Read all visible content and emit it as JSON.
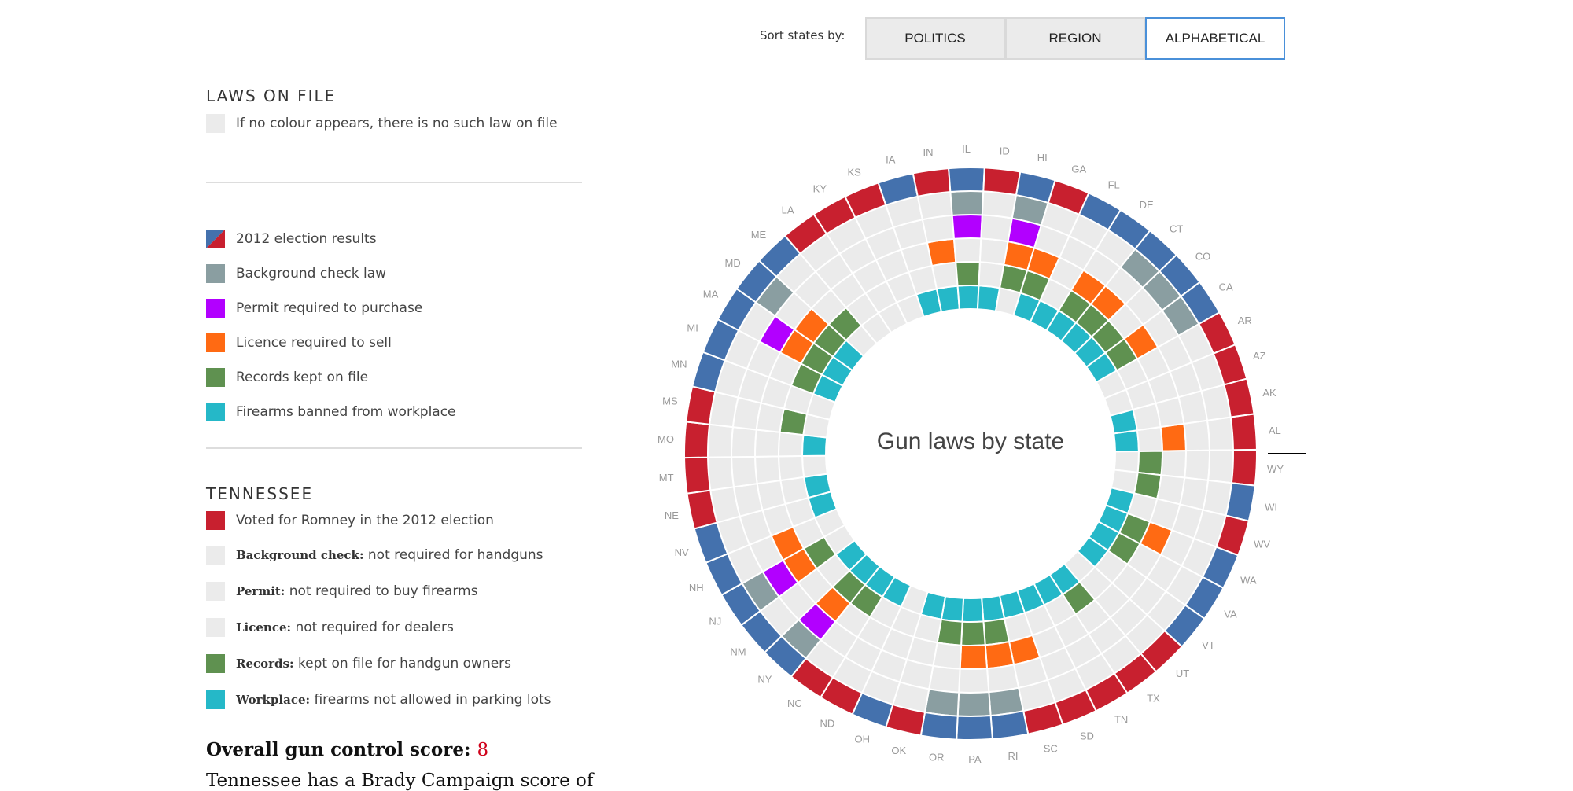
{
  "sort": {
    "label": "Sort states by:",
    "options": [
      "POLITICS",
      "REGION",
      "ALPHABETICAL"
    ],
    "active": "ALPHABETICAL"
  },
  "laws_on_file": {
    "heading": "LAWS ON FILE",
    "note": "If no colour appears, there is no such law on file"
  },
  "legend": [
    {
      "key": "election",
      "label": "2012 election results"
    },
    {
      "key": "background",
      "label": "Background check law"
    },
    {
      "key": "permit",
      "label": "Permit required to purchase"
    },
    {
      "key": "licence",
      "label": "Licence required to sell"
    },
    {
      "key": "records",
      "label": "Records kept on file"
    },
    {
      "key": "workplace",
      "label": "Firearms banned from workplace"
    }
  ],
  "colors": {
    "rep": "#c8202f",
    "dem": "#4471ad",
    "background": "#8a9ea1",
    "permit": "#b200ff",
    "licence": "#ff6a13",
    "records": "#5f9150",
    "workplace": "#25b8c8",
    "empty": "#ebebeb",
    "highlight_line": "#000000"
  },
  "selected_state": {
    "name": "TENNESSEE",
    "election": "Voted for Romney in the 2012 election",
    "background_label": "Background check:",
    "background_text": "not required for handguns",
    "permit_label": "Permit:",
    "permit_text": "not required to buy firearms",
    "licence_label": "Licence:",
    "licence_text": "not required for dealers",
    "records_label": "Records:",
    "records_text": "kept on file for handgun owners",
    "workplace_label": "Workplace:",
    "workplace_text": "firearms not allowed in parking lots",
    "score_label": "Overall gun control score:",
    "score_value": "8",
    "blurb": "Tennessee has a Brady Campaign score of"
  },
  "chart_data": {
    "type": "radial-grid",
    "title": "Gun laws by state",
    "rings_inner_to_outer": [
      "workplace",
      "records",
      "licence",
      "permit",
      "background",
      "election"
    ],
    "states": [
      {
        "code": "AL",
        "election": "rep",
        "background": false,
        "permit": false,
        "licence": true,
        "records": false,
        "workplace": true
      },
      {
        "code": "WY",
        "election": "rep",
        "background": false,
        "permit": false,
        "licence": false,
        "records": true,
        "workplace": false
      },
      {
        "code": "WI",
        "election": "dem",
        "background": false,
        "permit": false,
        "licence": false,
        "records": true,
        "workplace": false
      },
      {
        "code": "WV",
        "election": "rep",
        "background": false,
        "permit": false,
        "licence": false,
        "records": false,
        "workplace": true
      },
      {
        "code": "WA",
        "election": "dem",
        "background": false,
        "permit": false,
        "licence": true,
        "records": true,
        "workplace": true
      },
      {
        "code": "VA",
        "election": "dem",
        "background": false,
        "permit": false,
        "licence": false,
        "records": true,
        "workplace": true
      },
      {
        "code": "VT",
        "election": "dem",
        "background": false,
        "permit": false,
        "licence": false,
        "records": false,
        "workplace": true
      },
      {
        "code": "UT",
        "election": "rep",
        "background": false,
        "permit": false,
        "licence": false,
        "records": false,
        "workplace": false
      },
      {
        "code": "TX",
        "election": "rep",
        "background": false,
        "permit": false,
        "licence": false,
        "records": true,
        "workplace": true
      },
      {
        "code": "TN",
        "election": "rep",
        "background": false,
        "permit": false,
        "licence": false,
        "records": false,
        "workplace": true
      },
      {
        "code": "SD",
        "election": "rep",
        "background": false,
        "permit": false,
        "licence": false,
        "records": false,
        "workplace": true
      },
      {
        "code": "SC",
        "election": "rep",
        "background": false,
        "permit": false,
        "licence": true,
        "records": false,
        "workplace": true
      },
      {
        "code": "RI",
        "election": "dem",
        "background": true,
        "permit": false,
        "licence": true,
        "records": true,
        "workplace": true
      },
      {
        "code": "PA",
        "election": "dem",
        "background": true,
        "permit": false,
        "licence": true,
        "records": true,
        "workplace": true
      },
      {
        "code": "OR",
        "election": "dem",
        "background": true,
        "permit": false,
        "licence": false,
        "records": true,
        "workplace": true
      },
      {
        "code": "OK",
        "election": "rep",
        "background": false,
        "permit": false,
        "licence": false,
        "records": false,
        "workplace": true
      },
      {
        "code": "OH",
        "election": "dem",
        "background": false,
        "permit": false,
        "licence": false,
        "records": false,
        "workplace": false
      },
      {
        "code": "ND",
        "election": "rep",
        "background": false,
        "permit": false,
        "licence": false,
        "records": false,
        "workplace": true
      },
      {
        "code": "NC",
        "election": "rep",
        "background": false,
        "permit": false,
        "licence": false,
        "records": true,
        "workplace": true
      },
      {
        "code": "NY",
        "election": "dem",
        "background": true,
        "permit": true,
        "licence": true,
        "records": true,
        "workplace": true
      },
      {
        "code": "NM",
        "election": "dem",
        "background": false,
        "permit": false,
        "licence": false,
        "records": false,
        "workplace": true
      },
      {
        "code": "NJ",
        "election": "dem",
        "background": true,
        "permit": true,
        "licence": true,
        "records": true,
        "workplace": false
      },
      {
        "code": "NH",
        "election": "dem",
        "background": false,
        "permit": false,
        "licence": true,
        "records": false,
        "workplace": false
      },
      {
        "code": "NV",
        "election": "dem",
        "background": false,
        "permit": false,
        "licence": false,
        "records": false,
        "workplace": true
      },
      {
        "code": "NE",
        "election": "rep",
        "background": false,
        "permit": false,
        "licence": false,
        "records": false,
        "workplace": true
      },
      {
        "code": "MT",
        "election": "rep",
        "background": false,
        "permit": false,
        "licence": false,
        "records": false,
        "workplace": false
      },
      {
        "code": "MO",
        "election": "rep",
        "background": false,
        "permit": false,
        "licence": false,
        "records": false,
        "workplace": true
      },
      {
        "code": "MS",
        "election": "rep",
        "background": false,
        "permit": false,
        "licence": false,
        "records": true,
        "workplace": false
      },
      {
        "code": "MN",
        "election": "dem",
        "background": false,
        "permit": false,
        "licence": false,
        "records": false,
        "workplace": false
      },
      {
        "code": "MI",
        "election": "dem",
        "background": false,
        "permit": false,
        "licence": false,
        "records": true,
        "workplace": true
      },
      {
        "code": "MA",
        "election": "dem",
        "background": false,
        "permit": true,
        "licence": true,
        "records": true,
        "workplace": true
      },
      {
        "code": "MD",
        "election": "dem",
        "background": true,
        "permit": false,
        "licence": true,
        "records": true,
        "workplace": true
      },
      {
        "code": "ME",
        "election": "dem",
        "background": false,
        "permit": false,
        "licence": false,
        "records": true,
        "workplace": false
      },
      {
        "code": "LA",
        "election": "rep",
        "background": false,
        "permit": false,
        "licence": false,
        "records": false,
        "workplace": false
      },
      {
        "code": "KY",
        "election": "rep",
        "background": false,
        "permit": false,
        "licence": false,
        "records": false,
        "workplace": false
      },
      {
        "code": "KS",
        "election": "rep",
        "background": false,
        "permit": false,
        "licence": false,
        "records": false,
        "workplace": false
      },
      {
        "code": "IA",
        "election": "dem",
        "background": false,
        "permit": false,
        "licence": false,
        "records": false,
        "workplace": true
      },
      {
        "code": "IN",
        "election": "rep",
        "background": false,
        "permit": false,
        "licence": true,
        "records": false,
        "workplace": true
      },
      {
        "code": "IL",
        "election": "dem",
        "background": true,
        "permit": true,
        "licence": false,
        "records": true,
        "workplace": true
      },
      {
        "code": "ID",
        "election": "rep",
        "background": false,
        "permit": false,
        "licence": false,
        "records": false,
        "workplace": true
      },
      {
        "code": "HI",
        "election": "dem",
        "background": true,
        "permit": true,
        "licence": true,
        "records": true,
        "workplace": false
      },
      {
        "code": "GA",
        "election": "rep",
        "background": false,
        "permit": false,
        "licence": true,
        "records": true,
        "workplace": true
      },
      {
        "code": "FL",
        "election": "dem",
        "background": false,
        "permit": false,
        "licence": false,
        "records": false,
        "workplace": true
      },
      {
        "code": "DE",
        "election": "dem",
        "background": false,
        "permit": false,
        "licence": true,
        "records": true,
        "workplace": true
      },
      {
        "code": "CT",
        "election": "dem",
        "background": true,
        "permit": false,
        "licence": true,
        "records": true,
        "workplace": true
      },
      {
        "code": "CO",
        "election": "dem",
        "background": true,
        "permit": false,
        "licence": false,
        "records": true,
        "workplace": true
      },
      {
        "code": "CA",
        "election": "dem",
        "background": true,
        "permit": false,
        "licence": true,
        "records": true,
        "workplace": true
      },
      {
        "code": "AR",
        "election": "rep",
        "background": false,
        "permit": false,
        "licence": false,
        "records": false,
        "workplace": false
      },
      {
        "code": "AZ",
        "election": "rep",
        "background": false,
        "permit": false,
        "licence": false,
        "records": false,
        "workplace": false
      },
      {
        "code": "AK",
        "election": "rep",
        "background": false,
        "permit": false,
        "licence": false,
        "records": false,
        "workplace": true
      }
    ]
  }
}
